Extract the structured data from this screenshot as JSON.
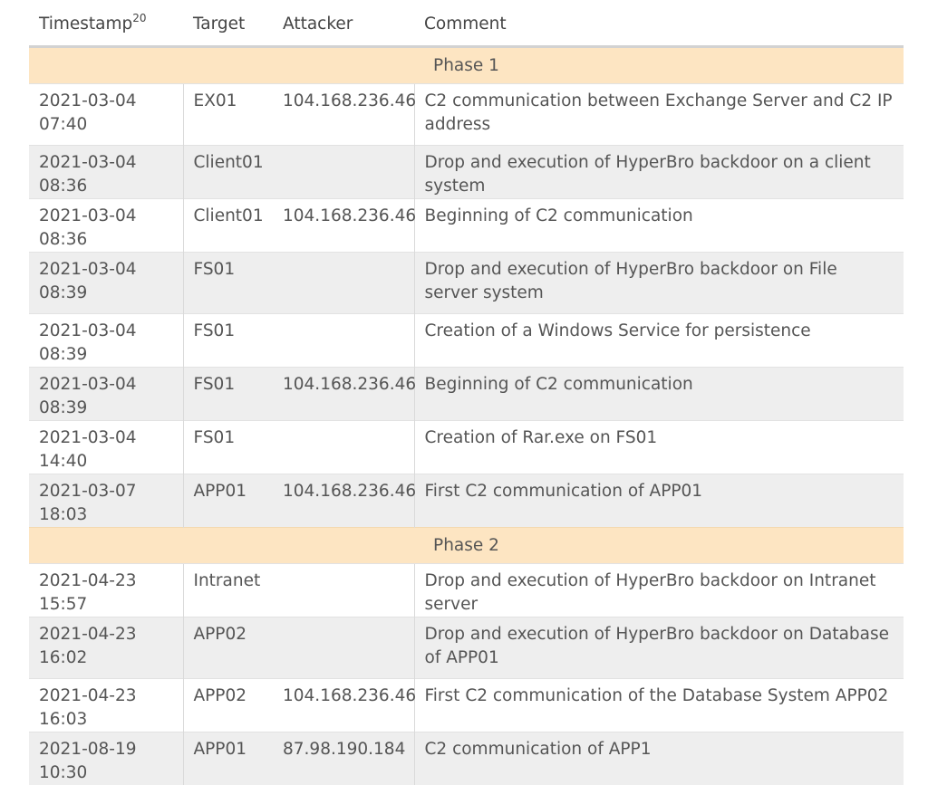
{
  "header": {
    "timestamp": "Timestamp",
    "footnote": "20",
    "target": "Target",
    "attacker": "Attacker",
    "comment": "Comment"
  },
  "phases": [
    {
      "label": "Phase 1",
      "rows": [
        {
          "timestamp": "2021-03-04 07:40",
          "target": "EX01",
          "attacker": "104.168.236.46",
          "comment": "C2 communication between Exchange Server and C2 IP address"
        },
        {
          "timestamp": "2021-03-04 08:36",
          "target": "Client01",
          "attacker": "",
          "comment": "Drop and execution of HyperBro backdoor on a client system"
        },
        {
          "timestamp": "2021-03-04 08:36",
          "target": "Client01",
          "attacker": "104.168.236.46",
          "comment": "Beginning of C2 communication"
        },
        {
          "timestamp": "2021-03-04 08:39",
          "target": "FS01",
          "attacker": "",
          "comment": "Drop and execution of HyperBro backdoor on File server system"
        },
        {
          "timestamp": "2021-03-04 08:39",
          "target": "FS01",
          "attacker": "",
          "comment": "Creation of a Windows Service for persistence"
        },
        {
          "timestamp": "2021-03-04 08:39",
          "target": "FS01",
          "attacker": "104.168.236.46",
          "comment": "Beginning of C2 communication"
        },
        {
          "timestamp": "2021-03-04 14:40",
          "target": "FS01",
          "attacker": "",
          "comment": "Creation of Rar.exe on FS01"
        },
        {
          "timestamp": "2021-03-07 18:03",
          "target": "APP01",
          "attacker": "104.168.236.46",
          "comment": "First C2 communication of APP01"
        }
      ]
    },
    {
      "label": "Phase 2",
      "rows": [
        {
          "timestamp": "2021-04-23 15:57",
          "target": "Intranet",
          "attacker": "",
          "comment": "Drop and execution of HyperBro backdoor on Intranet server"
        },
        {
          "timestamp": "2021-04-23 16:02",
          "target": "APP02",
          "attacker": "",
          "comment": "Drop and execution of HyperBro backdoor on Database of APP01"
        },
        {
          "timestamp": "2021-04-23 16:03",
          "target": "APP02",
          "attacker": "104.168.236.46",
          "comment": "First C2 communication of the Database System APP02"
        },
        {
          "timestamp": "2021-08-19 10:30",
          "target": "APP01",
          "attacker": "87.98.190.184",
          "comment": "C2 communication of APP1"
        }
      ]
    }
  ]
}
